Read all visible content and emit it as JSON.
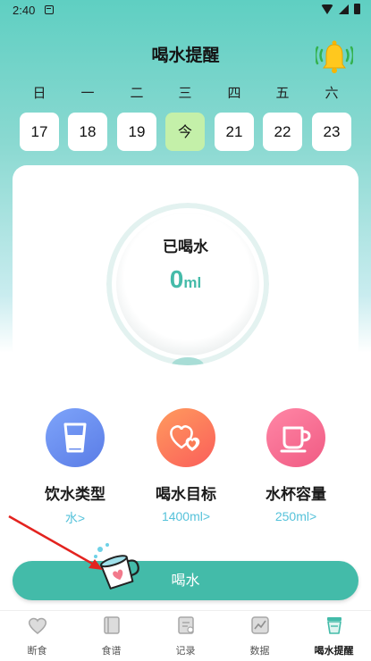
{
  "status_bar": {
    "time": "2:40"
  },
  "header": {
    "title": "喝水提醒",
    "bell_icon": "bell-ringing-icon"
  },
  "week": {
    "weekdays": [
      "日",
      "一",
      "二",
      "三",
      "四",
      "五",
      "六"
    ],
    "dates": [
      "17",
      "18",
      "19",
      "今",
      "21",
      "22",
      "23"
    ],
    "today_color": "#c4f0a9"
  },
  "intake": {
    "label": "已喝水",
    "amount": "0",
    "unit": "ml",
    "accent": "#45bba9"
  },
  "features": [
    {
      "label": "饮水类型",
      "value": "水>",
      "icon": "water-glass-icon",
      "color": "#6c8ff0"
    },
    {
      "label": "喝水目标",
      "value": "1400ml>",
      "icon": "hearts-icon",
      "color": "#fb7b54"
    },
    {
      "label": "水杯容量",
      "value": "250ml>",
      "icon": "mug-icon",
      "color": "#f5698c"
    }
  ],
  "drink_button": {
    "label": "喝水",
    "color": "#43bba9"
  },
  "tabs": [
    {
      "label": "断食",
      "icon": "heart-icon"
    },
    {
      "label": "食谱",
      "icon": "book-icon"
    },
    {
      "label": "记录",
      "icon": "notes-icon"
    },
    {
      "label": "数据",
      "icon": "chart-icon"
    },
    {
      "label": "喝水提醒",
      "icon": "cup-icon",
      "active": true
    }
  ]
}
